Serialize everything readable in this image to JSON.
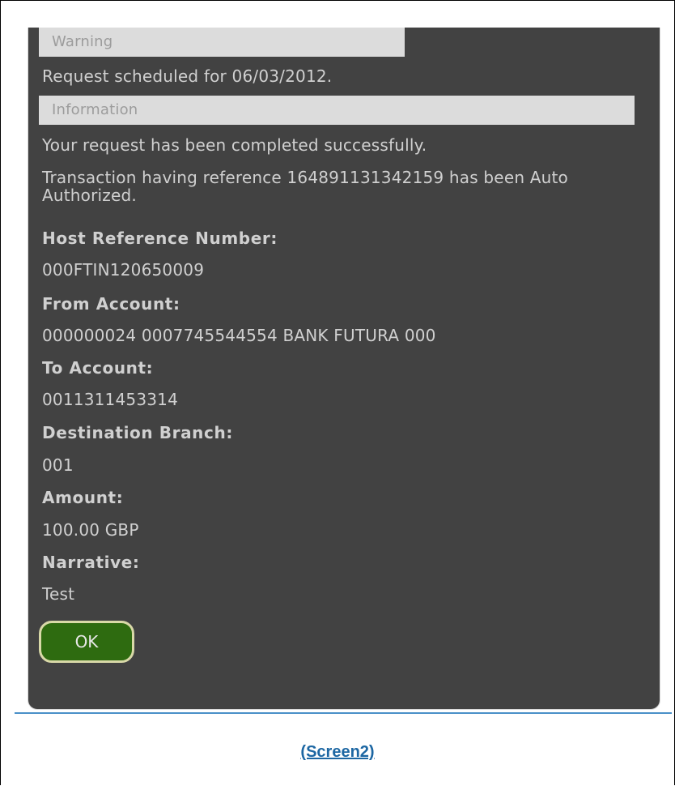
{
  "warning": {
    "label": "Warning",
    "message": "Request scheduled for 06/03/2012."
  },
  "information": {
    "label": "Information",
    "message_1": "Your request has been completed successfully.",
    "message_2": "Transaction having reference 164891131342159 has been Auto Authorized."
  },
  "details": {
    "host_reference": {
      "label": "Host Reference Number:",
      "value": "000FTIN120650009"
    },
    "from_account": {
      "label": "From Account:",
      "value": "000000024 0007745544554 BANK FUTURA 000"
    },
    "to_account": {
      "label": "To Account:",
      "value": "0011311453314"
    },
    "destination_branch": {
      "label": "Destination Branch:",
      "value": "001"
    },
    "amount": {
      "label": "Amount:",
      "value": "100.00 GBP"
    },
    "narrative": {
      "label": "Narrative:",
      "value": "Test"
    }
  },
  "actions": {
    "ok_label": "OK"
  },
  "footer": {
    "link_text": "(Screen2)"
  },
  "colors": {
    "panel_background": "#424242",
    "message_bar": "#dcdcdc",
    "ok_button": "#2e6b10",
    "link": "#1d67a3",
    "divider": "#4a90c8"
  }
}
